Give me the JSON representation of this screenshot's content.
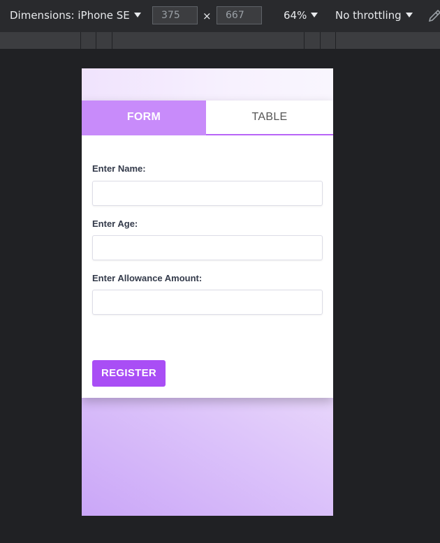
{
  "devtools": {
    "dimensions_label": "Dimensions: iPhone SE",
    "width_value": "375",
    "height_value": "667",
    "times_symbol": "×",
    "zoom": "64%",
    "throttling": "No throttling",
    "icons": {
      "dropdown": "caret-down-icon",
      "picker": "eyedropper-icon"
    }
  },
  "app": {
    "tabs": [
      {
        "label": "FORM",
        "active": true
      },
      {
        "label": "TABLE",
        "active": false
      }
    ],
    "form": {
      "fields": [
        {
          "label": "Enter Name:",
          "value": "",
          "placeholder": ""
        },
        {
          "label": "Enter Age:",
          "value": "",
          "placeholder": ""
        },
        {
          "label": "Enter Allowance Amount:",
          "value": "",
          "placeholder": ""
        }
      ],
      "submit_label": "REGISTER"
    }
  },
  "colors": {
    "tab_active_bg": "#c88bfa",
    "accent_border": "#b865f7",
    "button_bg": "#a94ef5",
    "page_gradient": "#caa6f8"
  }
}
